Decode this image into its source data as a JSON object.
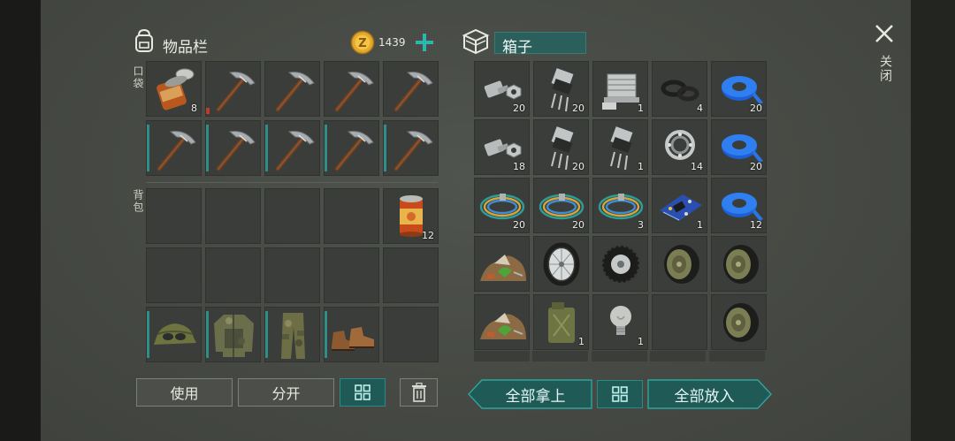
{
  "inventory": {
    "title": "物品栏",
    "coins": "1439",
    "pocket_label": "口袋",
    "backpack_label": "背包",
    "pocket_slots": [
      {
        "item": "canned-food-icon",
        "count": "8"
      },
      {
        "item": "pickaxe-icon",
        "count": ""
      },
      {
        "item": "pickaxe-icon",
        "count": ""
      },
      {
        "item": "pickaxe-icon",
        "count": ""
      },
      {
        "item": "pickaxe-icon",
        "count": ""
      },
      {
        "item": "pickaxe-icon",
        "count": ""
      },
      {
        "item": "pickaxe-icon",
        "count": ""
      },
      {
        "item": "pickaxe-icon",
        "count": ""
      },
      {
        "item": "pickaxe-icon",
        "count": ""
      },
      {
        "item": "pickaxe-icon",
        "count": ""
      }
    ],
    "backpack_slots": [
      {
        "item": "",
        "count": ""
      },
      {
        "item": "",
        "count": ""
      },
      {
        "item": "",
        "count": ""
      },
      {
        "item": "",
        "count": ""
      },
      {
        "item": "food-can-icon",
        "count": "12"
      },
      {
        "item": "",
        "count": ""
      },
      {
        "item": "",
        "count": ""
      },
      {
        "item": "",
        "count": ""
      },
      {
        "item": "",
        "count": ""
      },
      {
        "item": "",
        "count": ""
      },
      {
        "item": "military-cap-icon",
        "count": ""
      },
      {
        "item": "camo-jacket-icon",
        "count": ""
      },
      {
        "item": "camo-pants-icon",
        "count": ""
      },
      {
        "item": "boots-icon",
        "count": ""
      },
      {
        "item": "",
        "count": ""
      }
    ],
    "buttons": {
      "use": "使用",
      "split": "分开"
    }
  },
  "box": {
    "title": "箱子",
    "slots": [
      {
        "item": "bolt-nut-icon",
        "count": "20"
      },
      {
        "item": "transistor-icon",
        "count": "20"
      },
      {
        "item": "engine-block-icon",
        "count": "1"
      },
      {
        "item": "rubber-ring-icon",
        "count": "4"
      },
      {
        "item": "blue-tape-icon",
        "count": "20"
      },
      {
        "item": "bolt-nut-icon",
        "count": "18"
      },
      {
        "item": "transistor-icon",
        "count": "20"
      },
      {
        "item": "transistor-icon",
        "count": "1"
      },
      {
        "item": "bearing-icon",
        "count": "14"
      },
      {
        "item": "blue-tape-icon",
        "count": "20"
      },
      {
        "item": "wire-coil-icon",
        "count": "20"
      },
      {
        "item": "wire-coil-icon",
        "count": "20"
      },
      {
        "item": "wire-coil-icon",
        "count": "3"
      },
      {
        "item": "circuit-board-icon",
        "count": "1"
      },
      {
        "item": "blue-tape-icon",
        "count": "12"
      },
      {
        "item": "scrap-pile-icon",
        "count": ""
      },
      {
        "item": "spoked-wheel-icon",
        "count": ""
      },
      {
        "item": "tire-icon",
        "count": ""
      },
      {
        "item": "green-wheel-icon",
        "count": ""
      },
      {
        "item": "green-wheel-icon",
        "count": ""
      },
      {
        "item": "scrap-pile-icon",
        "count": ""
      },
      {
        "item": "jerrycan-icon",
        "count": "1"
      },
      {
        "item": "light-bulb-icon",
        "count": "1"
      },
      {
        "item": "",
        "count": ""
      },
      {
        "item": "green-wheel-icon",
        "count": ""
      }
    ],
    "buttons": {
      "take_all": "全部拿上",
      "put_all": "全部放入"
    }
  },
  "close_label": "关闭",
  "colors": {
    "accent": "#2f8f88",
    "teal_button": "#1f5a57"
  }
}
